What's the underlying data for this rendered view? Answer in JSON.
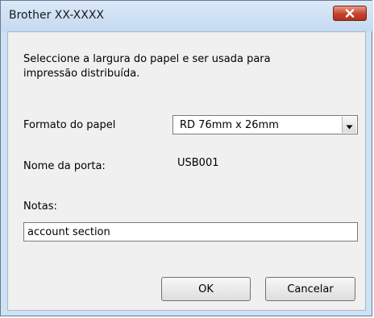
{
  "window": {
    "title": "Brother XX-XXXX"
  },
  "icons": {
    "close": "close-icon",
    "dropdown": "chevron-down-icon"
  },
  "dialog": {
    "instruction_line1": "Seleccione a largura do papel e ser usada para",
    "instruction_line2": "impressão distribuída.",
    "paper_format_label": "Formato do papel",
    "paper_format_value": "RD 76mm x 26mm",
    "port_name_label": "Nome da porta:",
    "port_name_value": "USB001",
    "notes_label": "Notas:",
    "notes_value": "account section"
  },
  "buttons": {
    "ok": "OK",
    "cancel": "Cancelar"
  },
  "colors": {
    "close_button": "#c7412b",
    "title_bar": "#cfe1f4",
    "client_background": "#f0f0f0"
  }
}
